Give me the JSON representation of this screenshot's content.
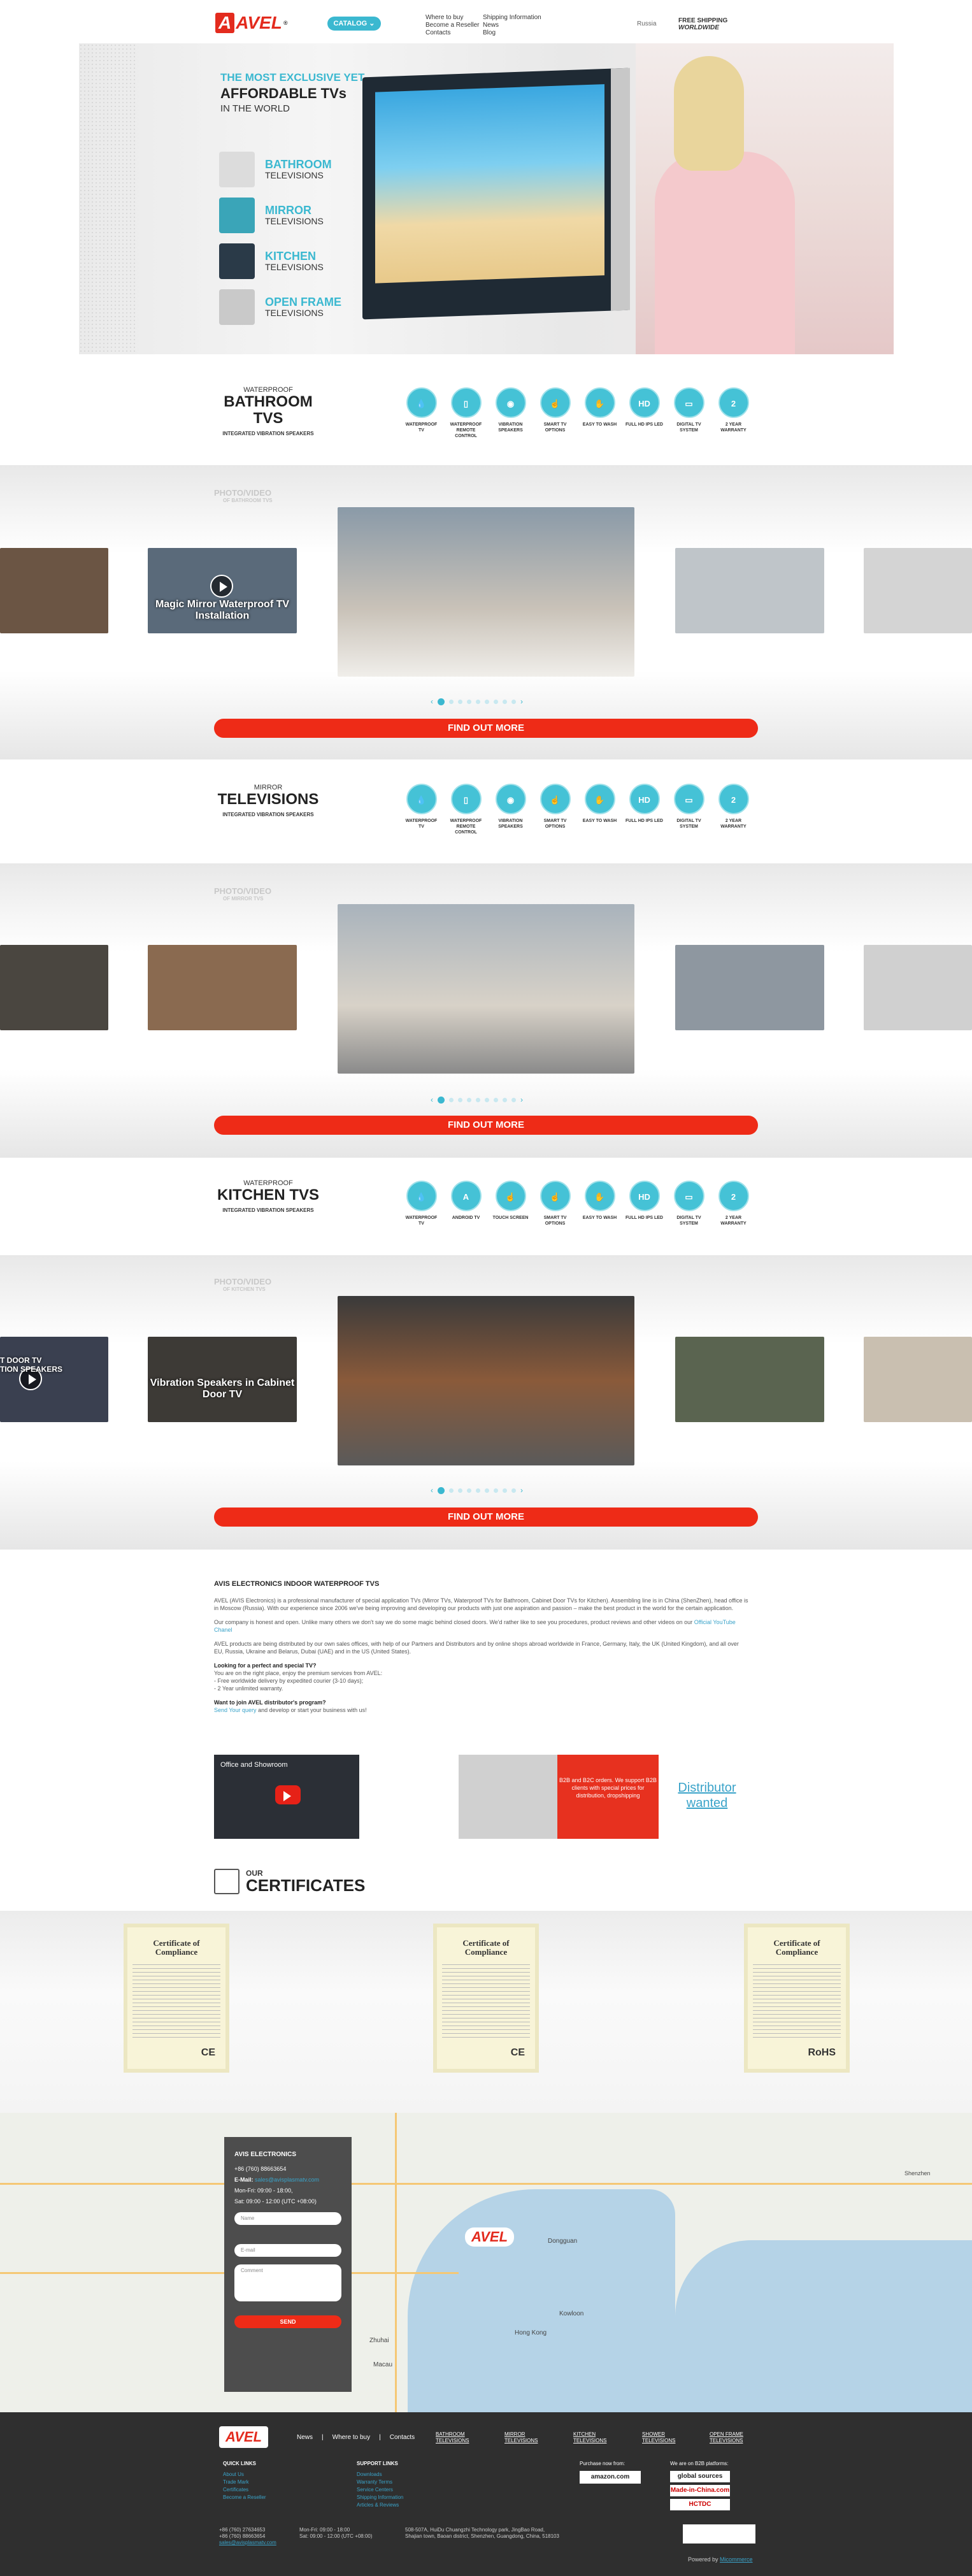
{
  "header": {
    "logo_text": "AVEL",
    "logo_reg": "®",
    "catalog_label": "CATALOG ⌄",
    "nav_col1": [
      "Where to buy",
      "Become a Reseller",
      "Contacts"
    ],
    "nav_col2": [
      "Shipping Information",
      "News",
      "Blog"
    ],
    "language": "Russia",
    "shipping_line1": "FREE SHIPPING",
    "shipping_line2": "WORLDWIDE"
  },
  "hero": {
    "title1": "THE MOST EXCLUSIVE YET",
    "title2": "AFFORDABLE TVs",
    "title3": "IN THE WORLD",
    "items": [
      {
        "t1": "BATHROOM",
        "t2": "TELEVISIONS"
      },
      {
        "t1": "MIRROR",
        "t2": "TELEVISIONS"
      },
      {
        "t1": "KITCHEN",
        "t2": "TELEVISIONS"
      },
      {
        "t1": "OPEN FRAME",
        "t2": "TELEVISIONS"
      }
    ]
  },
  "sections": [
    {
      "small": "WATERPROOF",
      "big": "BATHROOM TVS",
      "sub": "INTEGRATED VIBRATION SPEAKERS",
      "features": [
        {
          "sym": "💧",
          "lbl": "WATERPROOF TV"
        },
        {
          "sym": "▯",
          "lbl": "WATERPROOF REMOTE CONTROL"
        },
        {
          "sym": "◉",
          "lbl": "VIBRATION SPEAKERS"
        },
        {
          "sym": "☝",
          "lbl": "SMART TV OPTIONS"
        },
        {
          "sym": "✋",
          "lbl": "EASY TO WASH"
        },
        {
          "sym": "HD",
          "lbl": "FULL HD IPS LED"
        },
        {
          "sym": "▭",
          "lbl": "DIGITAL TV SYSTEM"
        },
        {
          "sym": "2",
          "lbl": "2 YEAR WARRANTY"
        }
      ],
      "gallery_title": "PHOTO/VIDEO",
      "gallery_sub": "OF BATHROOM TVS",
      "video_caption": "Magic Mirror Waterproof TV Installation",
      "button": "FIND OUT MORE"
    },
    {
      "small": "MIRROR",
      "big": "TELEVISIONS",
      "sub": "INTEGRATED VIBRATION SPEAKERS",
      "features": [
        {
          "sym": "💧",
          "lbl": "WATERPROOF TV"
        },
        {
          "sym": "▯",
          "lbl": "WATERPROOF REMOTE CONTROL"
        },
        {
          "sym": "◉",
          "lbl": "VIBRATION SPEAKERS"
        },
        {
          "sym": "☝",
          "lbl": "SMART TV OPTIONS"
        },
        {
          "sym": "✋",
          "lbl": "EASY TO WASH"
        },
        {
          "sym": "HD",
          "lbl": "FULL HD IPS LED"
        },
        {
          "sym": "▭",
          "lbl": "DIGITAL TV SYSTEM"
        },
        {
          "sym": "2",
          "lbl": "2 YEAR WARRANTY"
        }
      ],
      "gallery_title": "PHOTO/VIDEO",
      "gallery_sub": "OF MIRROR TVS",
      "video_caption": "",
      "button": "FIND OUT MORE"
    },
    {
      "small": "WATERPROOF",
      "big": "KITCHEN TVS",
      "sub": "INTEGRATED VIBRATION SPEAKERS",
      "features": [
        {
          "sym": "💧",
          "lbl": "WATERPROOF TV"
        },
        {
          "sym": "A",
          "lbl": "ANDROID TV"
        },
        {
          "sym": "☝",
          "lbl": "TOUCH SCREEN"
        },
        {
          "sym": "☝",
          "lbl": "SMART TV OPTIONS"
        },
        {
          "sym": "✋",
          "lbl": "EASY TO WASH"
        },
        {
          "sym": "HD",
          "lbl": "FULL HD IPS LED"
        },
        {
          "sym": "▭",
          "lbl": "DIGITAL TV SYSTEM"
        },
        {
          "sym": "2",
          "lbl": "2 YEAR WARRANTY"
        }
      ],
      "gallery_title": "PHOTO/VIDEO",
      "gallery_sub": "OF KITCHEN TVS",
      "video_caption": "Vibration Speakers in Cabinet Door TV",
      "side_caption": "T DOOR TV\nTION SPEAKERS",
      "button": "FIND OUT MORE"
    }
  ],
  "about": {
    "title": "AVIS ELECTRONICS INDOOR WATERPROOF TVS",
    "p1": "AVEL (AVIS Electronics) is a professional manufacturer of special application TVs (Mirror TVs, Waterproof TVs for Bathroom, Cabinet Door TVs for Kitchen). Assembling line is in China (ShenZhen), head office is in Moscow (Russia). With our experience since 2006 we've being improving and developing our products with just one aspiration and passion – make the best product in the world for the certain application.",
    "p2": "Our company is honest and open. Unlike many others we don't say we do some magic behind closed doors. We'd rather like to see you procedures, product reviews and other videos on our",
    "p2_link": "Official YouTube Chanel",
    "p3": "AVEL products are being distributed by our own sales offices, with help of our Partners and Distributors and by online shops abroad worldwide in France, Germany, Italy, the UK (United Kingdom), and all over EU, Russia, Ukraine and Belarus, Dubai (UAE) and in the US (United States).",
    "q1": "Looking for a perfect and special TV?",
    "q1_lines": [
      "You are on the right place, enjoy the premium services from AVEL:",
      "- Free worldwide delivery by expedited courier (3-10 days);",
      "- 2 Year unlimited warranty."
    ],
    "q2": "Want to join AVEL distributor's program?",
    "q2_link": "Send Your query",
    "q2_rest": "and develop or start your business with us!",
    "video_title": "Office and Showroom",
    "b2b_text": "B2B and B2C orders. We support B2B clients with special prices for distribution, dropshipping",
    "distributor_link": "Distributor wanted"
  },
  "certificates": {
    "our": "OUR",
    "title": "CERTIFICATES",
    "items": [
      {
        "title": "Certificate of Compliance",
        "mark": "CE"
      },
      {
        "title": "Certificate of Compliance",
        "mark": "CE"
      },
      {
        "title": "Certificate of Compliance",
        "mark": "RoHS"
      }
    ]
  },
  "contact": {
    "company": "AVIS ELECTRONICS",
    "phone": "+86 (760) 88663654",
    "email_label": "E-Mail:",
    "email": "sales@avisplasmatv.com",
    "hours1": "Mon-Fri: 09:00 - 18:00,",
    "hours2": "Sat: 09:00 - 12:00 (UTC +08:00)",
    "name_placeholder": "Name",
    "email_placeholder": "E-mail",
    "comment_placeholder": "Comment",
    "send": "SEND",
    "map_labels": [
      "Shenzhen",
      "Hong Kong",
      "Kowloon",
      "Macau",
      "Zhuhai",
      "Dongguan"
    ]
  },
  "footer": {
    "logo": "AVEL",
    "top_links": [
      "News",
      "Where to buy",
      "Contacts"
    ],
    "categories": [
      "BATHROOM TELEVISIONS",
      "MIRROR TELEVISIONS",
      "KITCHEN TELEVISIONS",
      "SHOWER TELEVISIONS",
      "OPEN FRAME TELEVISIONS"
    ],
    "quick_head": "QUICK LINKS",
    "quick": [
      "About Us",
      "Trade Mark",
      "Certificates",
      "Become a Reseller"
    ],
    "support_head": "SUPPORT LINKS",
    "support": [
      "Downloads",
      "Warranty Terms",
      "Service Centers",
      "Shipping Information",
      "Articles & Reviews"
    ],
    "purchase_head": "Purchase now from:",
    "purchase": "amazon.com",
    "b2b_head": "We are on B2B platforms:",
    "b2b": [
      "global sources",
      "Made-in-China.com",
      "HCTDC"
    ],
    "phones": [
      "+86 (760) 27634653",
      "+86 (760) 88663654"
    ],
    "email": "sales@avisplasmatv.com",
    "hours": [
      "Mon-Fri: 09:00 - 18:00",
      "Sat: 09:00 - 12:00 (UTC +08:00)"
    ],
    "address": [
      "508-507A, HuiDu Chuangzhi Technology park, JingBao Road,",
      "Shajian town, Baoan district, Shenzhen, Guangdong, China, 518103"
    ],
    "powered": "Powered by",
    "powered_link": "Micommerce"
  },
  "colors": {
    "accent": "#3bb8d0",
    "brand_red": "#e32b1e",
    "button_red": "#ee2b17"
  }
}
